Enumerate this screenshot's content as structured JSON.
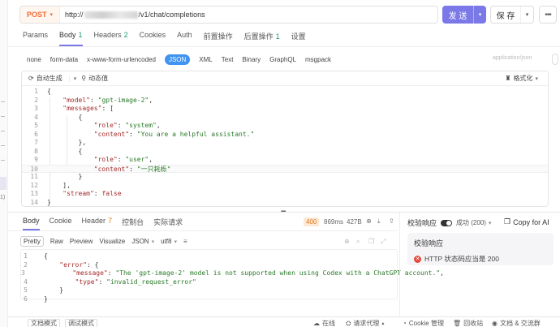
{
  "url_bar": {
    "method": "POST",
    "url_prefix": "http://",
    "url_suffix": "/v1/chat/completions"
  },
  "actions": {
    "send": "发 送",
    "save": "保 存"
  },
  "request_tabs": [
    {
      "label": "Params",
      "count": ""
    },
    {
      "label": "Body",
      "count": "1"
    },
    {
      "label": "Headers",
      "count": "2"
    },
    {
      "label": "Cookies",
      "count": ""
    },
    {
      "label": "Auth",
      "count": ""
    },
    {
      "label": "前置操作",
      "count": ""
    },
    {
      "label": "后置操作",
      "count": "1"
    },
    {
      "label": "设置",
      "count": ""
    }
  ],
  "body_types": [
    "none",
    "form-data",
    "x-www-form-urlencoded",
    "JSON",
    "XML",
    "Text",
    "Binary",
    "GraphQL",
    "msgpack"
  ],
  "body_type_active": "JSON",
  "content_type_hint": "application/json",
  "editor_toolbar": {
    "auto_generate": "自动生成",
    "dynamic_value": "动态值",
    "format": "格式化"
  },
  "request_lines": [
    {
      "n": "1",
      "html": "<span class='p'>{</span>"
    },
    {
      "n": "2",
      "html": "    <span class='k'>\"model\"</span><span class='p'>: </span><span class='s'>\"gpt-image-2\"</span><span class='p'>,</span>"
    },
    {
      "n": "3",
      "html": "    <span class='k'>\"messages\"</span><span class='p'>: [</span>"
    },
    {
      "n": "4",
      "html": "        <span class='p'>{</span>"
    },
    {
      "n": "5",
      "html": "            <span class='k'>\"role\"</span><span class='p'>: </span><span class='s'>\"system\"</span><span class='p'>,</span>"
    },
    {
      "n": "6",
      "html": "            <span class='k'>\"content\"</span><span class='p'>: </span><span class='s'>\"You are a helpful assistant.\"</span>"
    },
    {
      "n": "7",
      "html": "        <span class='p'>},</span>"
    },
    {
      "n": "8",
      "html": "        <span class='p'>{</span>"
    },
    {
      "n": "9",
      "html": "            <span class='k'>\"role\"</span><span class='p'>: </span><span class='s'>\"user\"</span><span class='p'>,</span>"
    },
    {
      "n": "10",
      "html": "            <span class='k'>\"content\"</span><span class='p'>: </span><span class='s'>\"一只耗栎\"</span>"
    },
    {
      "n": "11",
      "html": "        <span class='p'>}</span>"
    },
    {
      "n": "12",
      "html": "    <span class='p'>],</span>"
    },
    {
      "n": "13",
      "html": "    <span class='k'>\"stream\"</span><span class='p'>: </span><span class='b'>false</span>"
    },
    {
      "n": "14",
      "html": "<span class='p'>}</span>"
    }
  ],
  "response_tabs": [
    {
      "label": "Body",
      "count": ""
    },
    {
      "label": "Cookie",
      "count": ""
    },
    {
      "label": "Header",
      "count": "7"
    },
    {
      "label": "控制台",
      "count": ""
    },
    {
      "label": "实际请求",
      "count": ""
    }
  ],
  "response_meta": {
    "status": "400",
    "time": "869ms",
    "size": "427B"
  },
  "response_formats": [
    "Pretty",
    "Raw",
    "Preview",
    "Visualize"
  ],
  "response_format_active": "Pretty",
  "response_lang": "JSON",
  "response_encoding": "utf8",
  "response_lines": [
    {
      "n": "1",
      "html": "<span class='p'>{</span>"
    },
    {
      "n": "2",
      "html": "    <span class='k'>\"error\"</span><span class='p'>: {</span>"
    },
    {
      "n": "3",
      "html": "        <span class='k'>\"message\"</span><span class='p'>: </span><span class='s'>\"The 'gpt-image-2' model is not supported when using Codex with a ChatGPT account.\"</span><span class='p'>,</span>"
    },
    {
      "n": "4",
      "html": "        <span class='k'>\"type\"</span><span class='p'>: </span><span class='s'>\"invalid_request_error\"</span>"
    },
    {
      "n": "5",
      "html": "    <span class='p'>}</span>"
    },
    {
      "n": "6",
      "html": "<span class='p'>}</span>"
    }
  ],
  "validation": {
    "title": "校验响应",
    "result": "成功 (200)",
    "copy_ai": "Copy for AI",
    "box_title": "校验响应",
    "item": "HTTP 状态码应当是 200"
  },
  "footer": {
    "doc_mode": "文档模式",
    "debug_mode": "调试模式",
    "online": "在线",
    "request_proxy": "请求代理",
    "cookie_mgmt": "Cookie 管理",
    "recycle": "回收站",
    "docs_community": "文档 & 交流群"
  },
  "colors": {
    "accent": "#7b78e8",
    "method": "#f16c35",
    "json_active": "#3f93f1",
    "status_400": "#e07b1e",
    "error": "#e5483b"
  }
}
